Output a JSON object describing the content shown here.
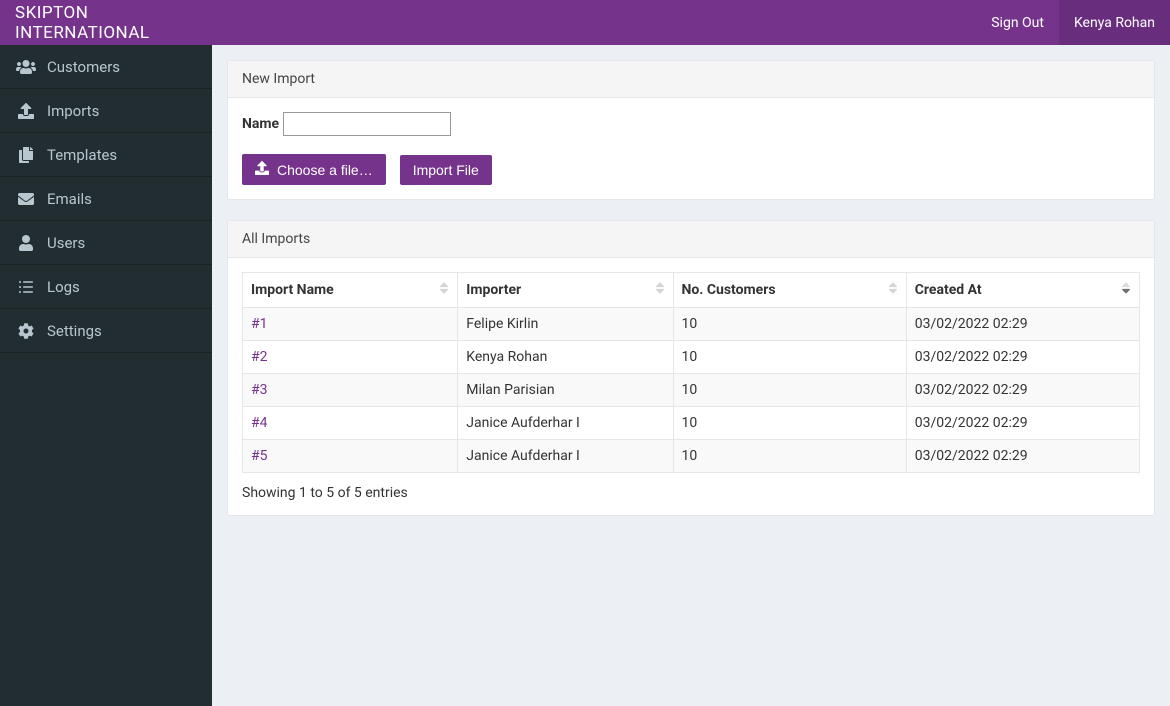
{
  "brand": "SKIPTON INTERNATIONAL",
  "topbar": {
    "sign_out": "Sign Out",
    "user_name": "Kenya Rohan"
  },
  "sidebar": {
    "items": [
      {
        "label": "Customers"
      },
      {
        "label": "Imports"
      },
      {
        "label": "Templates"
      },
      {
        "label": "Emails"
      },
      {
        "label": "Users"
      },
      {
        "label": "Logs"
      },
      {
        "label": "Settings"
      }
    ]
  },
  "new_import": {
    "title": "New Import",
    "name_label": "Name",
    "choose_file_label": "Choose a file…",
    "import_file_label": "Import File"
  },
  "all_imports": {
    "title": "All Imports",
    "columns": {
      "import_name": "Import Name",
      "importer": "Importer",
      "no_customers": "No. Customers",
      "created_at": "Created At"
    },
    "rows": [
      {
        "name": "#1",
        "importer": "Felipe Kirlin",
        "count": "10",
        "created": "03/02/2022 02:29"
      },
      {
        "name": "#2",
        "importer": "Kenya Rohan",
        "count": "10",
        "created": "03/02/2022 02:29"
      },
      {
        "name": "#3",
        "importer": "Milan Parisian",
        "count": "10",
        "created": "03/02/2022 02:29"
      },
      {
        "name": "#4",
        "importer": "Janice Aufderhar I",
        "count": "10",
        "created": "03/02/2022 02:29"
      },
      {
        "name": "#5",
        "importer": "Janice Aufderhar I",
        "count": "10",
        "created": "03/02/2022 02:29"
      }
    ],
    "info": "Showing 1 to 5 of 5 entries"
  }
}
